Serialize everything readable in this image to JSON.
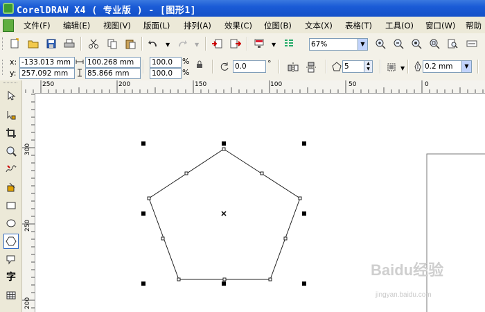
{
  "title_bar": {
    "title": "CorelDRAW X4 ( 专业版 ) - [图形1]"
  },
  "menu": {
    "items": [
      "文件(F)",
      "编辑(E)",
      "视图(V)",
      "版面(L)",
      "排列(A)",
      "效果(C)",
      "位图(B)",
      "文本(X)",
      "表格(T)",
      "工具(O)",
      "窗口(W)",
      "帮助"
    ]
  },
  "standard_toolbar": {
    "zoom_value": "67%",
    "icons": [
      "new-icon",
      "open-icon",
      "save-icon",
      "print-icon",
      "cut-icon",
      "copy-icon",
      "paste-icon",
      "undo-icon",
      "redo-icon",
      "import-icon",
      "export-icon",
      "app-launcher-icon",
      "welcome-icon",
      "zoom-in-icon",
      "zoom-out-icon",
      "zoom-all-icon",
      "zoom-selection-icon",
      "zoom-page-icon",
      "zoom-width-icon"
    ]
  },
  "property_bar": {
    "x_label": "x:",
    "x_value": "-133.013 mm",
    "y_label": "y:",
    "y_value": "257.092 mm",
    "width_value": "100.268 mm",
    "height_value": "85.866 mm",
    "scale_x": "100.0",
    "scale_y": "100.0",
    "percent_x": "%",
    "percent_y": "%",
    "rotation_value": "0.0",
    "degree_symbol": "°",
    "sides_value": "5",
    "outline_width": "0.2 mm"
  },
  "rulers": {
    "horizontal_labels": [
      "250",
      "200",
      "150",
      "100",
      "50",
      "0"
    ],
    "vertical_labels": [
      "300",
      "250",
      "200"
    ]
  },
  "watermark": {
    "text": "Baidu经验",
    "url": "jingyan.baidu.com"
  },
  "colors": {
    "titlebar": "#1a5bd6",
    "chrome": "#ece9d8",
    "accent": "#316ac5"
  }
}
